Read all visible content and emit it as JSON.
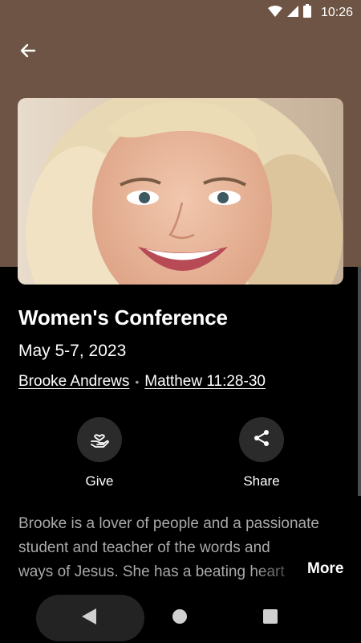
{
  "status_bar": {
    "time": "10:26",
    "icons": [
      "wifi-icon",
      "cellular-signal-icon",
      "battery-icon"
    ]
  },
  "header": {
    "back_icon": "arrow-left-icon"
  },
  "hero": {
    "image": "speaker-portrait-photo"
  },
  "event": {
    "title": "Women's Conference",
    "date": "May 5-7, 2023",
    "speaker": "Brooke Andrews",
    "separator": "•",
    "scripture": "Matthew 11:28-30"
  },
  "actions": {
    "give_label": "Give",
    "give_icon": "heart-hand-icon",
    "share_label": "Share",
    "share_icon": "share-icon"
  },
  "description": {
    "line1": "Brooke is a lover of people and a passionate",
    "line2": "student and teacher of the words and",
    "line3": "ways of Jesus. She has a beating heart",
    "more_label": "More"
  },
  "nav": {
    "back": "nav-back-icon",
    "home": "nav-home-icon",
    "recents": "nav-recents-icon"
  },
  "colors": {
    "header_bg": "#6e5444",
    "background": "#000000",
    "button_bg": "#2b2b2b",
    "muted_text": "#a9a9a9"
  }
}
